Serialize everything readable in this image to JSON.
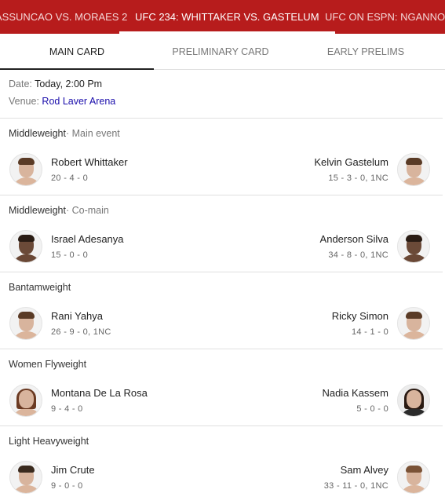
{
  "event_tabs": [
    {
      "label": "ASSUNCAO VS. MORAES 2",
      "active": false
    },
    {
      "label": "UFC 234: WHITTAKER VS. GASTELUM",
      "active": true
    },
    {
      "label": "UFC ON ESPN: NGANNOU VS",
      "active": false
    }
  ],
  "card_tabs": [
    {
      "label": "MAIN CARD",
      "active": true
    },
    {
      "label": "PRELIMINARY CARD",
      "active": false
    },
    {
      "label": "EARLY PRELIMS",
      "active": false
    }
  ],
  "info": {
    "date_label": "Date:",
    "date_value": "Today, 2:00 Pm",
    "venue_label": "Venue:",
    "venue_value": "Rod Laver Arena"
  },
  "bouts": [
    {
      "weight_class": "Middleweight",
      "bout_type": "· Main event",
      "left": {
        "name": "Robert Whittaker",
        "record": "20 - 4 - 0"
      },
      "right": {
        "name": "Kelvin Gastelum",
        "record": "15 - 3 - 0, 1NC"
      }
    },
    {
      "weight_class": "Middleweight",
      "bout_type": "· Co-main",
      "left": {
        "name": "Israel Adesanya",
        "record": "15 - 0 - 0"
      },
      "right": {
        "name": "Anderson Silva",
        "record": "34 - 8 - 0, 1NC"
      }
    },
    {
      "weight_class": "Bantamweight",
      "bout_type": "",
      "left": {
        "name": "Rani Yahya",
        "record": "26 - 9 - 0, 1NC"
      },
      "right": {
        "name": "Ricky Simon",
        "record": "14 - 1 - 0"
      }
    },
    {
      "weight_class": "Women Flyweight",
      "bout_type": "",
      "left": {
        "name": "Montana De La Rosa",
        "record": "9 - 4 - 0"
      },
      "right": {
        "name": "Nadia Kassem",
        "record": "5 - 0 - 0"
      }
    },
    {
      "weight_class": "Light Heavyweight",
      "bout_type": "",
      "left": {
        "name": "Jim Crute",
        "record": "9 - 0 - 0"
      },
      "right": {
        "name": "Sam Alvey",
        "record": "33 - 11 - 0, 1NC"
      }
    }
  ],
  "colors": {
    "header_bg": "#b71c1c",
    "link": "#1a0dab"
  }
}
